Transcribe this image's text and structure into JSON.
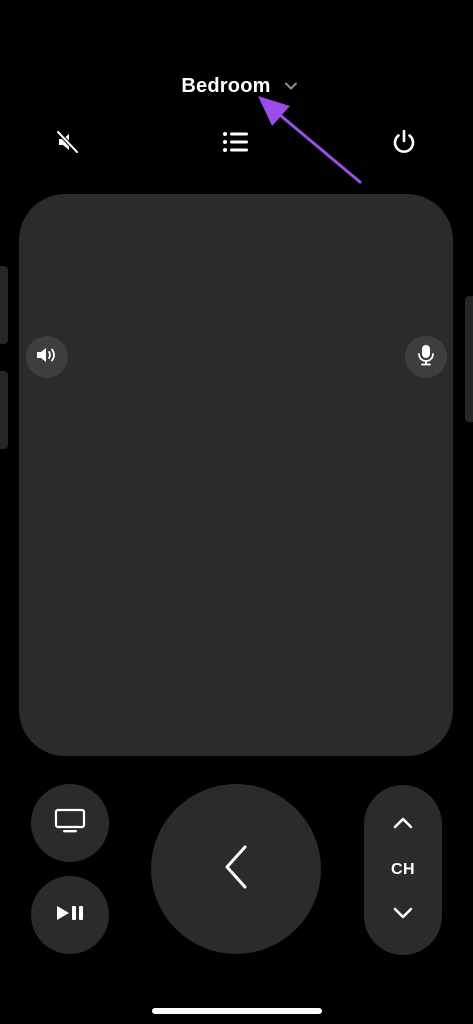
{
  "header": {
    "device_name": "Bedroom",
    "dropdown_icon": "chevron-down-icon"
  },
  "toolbar": {
    "mute_icon": "speaker-muted-icon",
    "list_icon": "list-icon",
    "power_icon": "power-icon"
  },
  "touch_surface": {
    "volume_icon": "speaker-volume-icon",
    "mic_icon": "microphone-icon"
  },
  "controls": {
    "tv_icon": "tv-icon",
    "play_pause_icon": "play-pause-icon",
    "back_icon": "chevron-left-icon",
    "channel": {
      "label": "CH",
      "up_icon": "chevron-up-icon",
      "down_icon": "chevron-down-icon"
    }
  },
  "colors": {
    "background": "#000000",
    "surface": "#2b2b2d",
    "icon": "#ffffff",
    "annotation_arrow": "#9b4de8"
  }
}
